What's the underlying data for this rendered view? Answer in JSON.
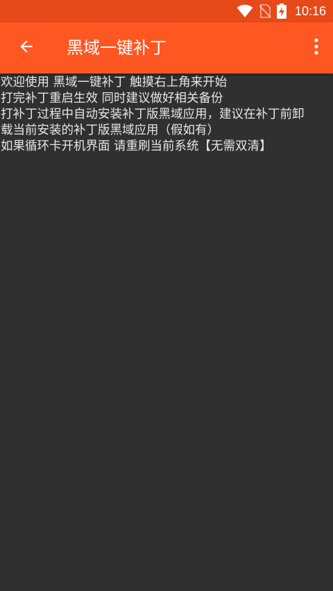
{
  "status_bar": {
    "time": "10:16",
    "icons": [
      "wifi-icon",
      "no-sim-icon",
      "battery-charging-icon"
    ],
    "background_color": "#e64a19"
  },
  "toolbar": {
    "title": "黑域一键补丁",
    "back_icon": "arrow-left-icon",
    "menu_icon": "more-vert-icon",
    "background_color": "#ff5722"
  },
  "content": {
    "lines": [
      "欢迎使用 黑域一键补丁 触摸右上角来开始",
      "打完补丁重启生效 同时建议做好相关备份",
      "打补丁过程中自动安装补丁版黑域应用，建议在补丁前卸",
      "载当前安装的补丁版黑域应用（假如有）",
      "如果循环卡开机界面 请重刷当前系统【无需双清】"
    ],
    "background_color": "#303030"
  }
}
